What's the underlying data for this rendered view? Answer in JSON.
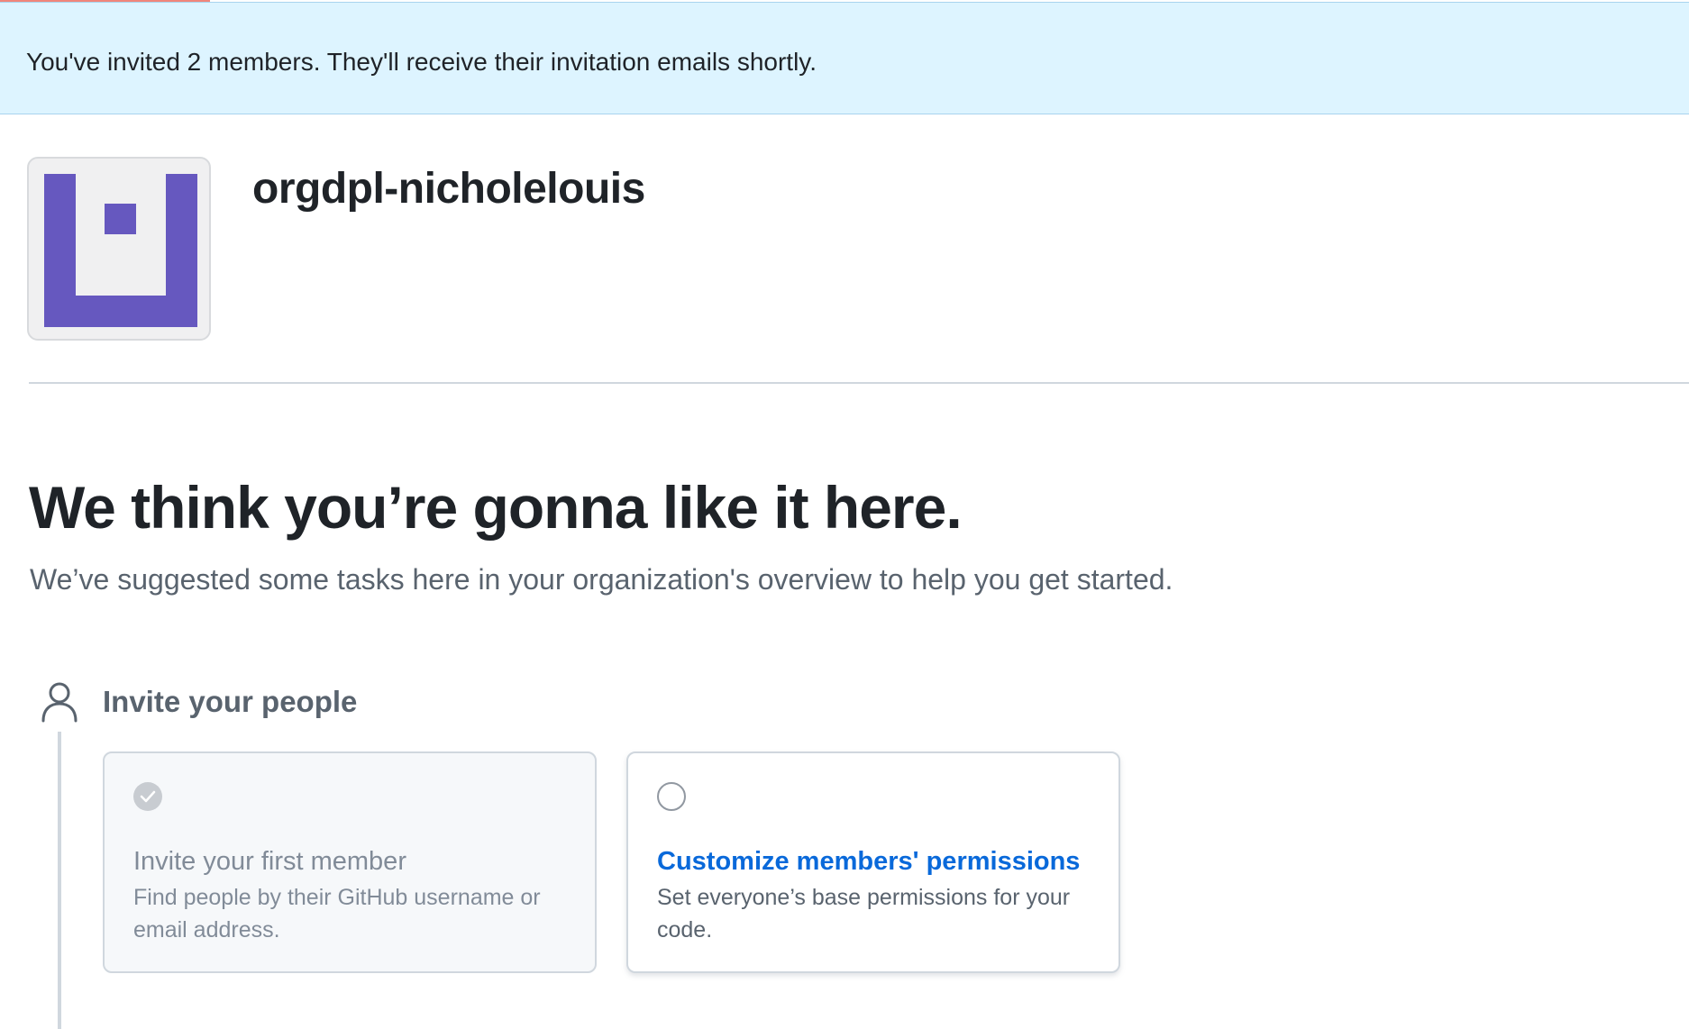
{
  "flash": {
    "message": "You've invited 2 members. They'll receive their invitation emails shortly."
  },
  "org": {
    "name": "orgdpl-nicholelouis",
    "avatar_color": "#6658bf"
  },
  "hero": {
    "title": "We think you’re gonna like it here.",
    "subtitle": "We’ve suggested some tasks here in your organization's overview to help you get started."
  },
  "section": {
    "icon": "person-icon",
    "title": "Invite your people"
  },
  "tasks": [
    {
      "status": "completed",
      "title": "Invite your first member",
      "description": "Find people by their GitHub username or email address."
    },
    {
      "status": "pending",
      "title": "Customize members' permissions",
      "description": "Set everyone’s base permissions for your code."
    }
  ],
  "colors": {
    "flash_bg": "#ddf4ff",
    "link": "#0969da",
    "progress_accent": "#f0857a"
  }
}
